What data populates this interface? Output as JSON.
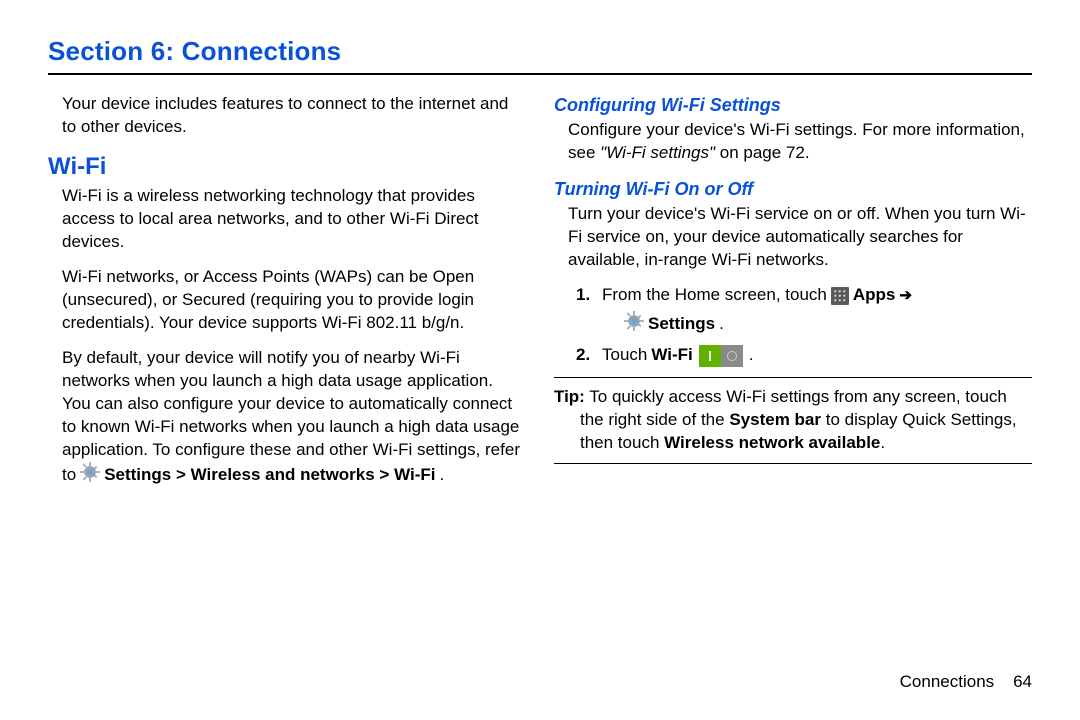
{
  "sectionTitle": "Section 6: Connections",
  "left": {
    "intro": "Your device includes features to connect to the internet and to other devices.",
    "wifiHeading": "Wi-Fi",
    "p1": "Wi-Fi is a wireless networking technology that provides access to local area networks, and to other Wi-Fi Direct devices.",
    "p2": "Wi-Fi networks, or Access Points (WAPs) can be Open (unsecured), or Secured (requiring you to provide login credentials). Your device supports Wi-Fi 802.11 b/g/n.",
    "p3a": "By default, your device will notify you of nearby Wi-Fi networks when you launch a high data usage application. You can also configure your device to automatically connect to known Wi-Fi networks when you launch a high data usage application. To configure these and other Wi-Fi settings, refer",
    "p3b_to": "to",
    "p3b_path": "Settings > Wireless and networks > Wi-Fi",
    "p3b_dot": "."
  },
  "right": {
    "configHeading": "Configuring Wi-Fi Settings",
    "config_a": "Configure your device's Wi-Fi settings. For more information, see",
    "config_ref": "\"Wi-Fi settings\"",
    "config_b": "on page 72.",
    "turnHeading": "Turning Wi-Fi On or Off",
    "turnIntro": "Turn your device's Wi-Fi service on or off. When you turn Wi-Fi service on, your device automatically searches for available, in-range Wi-Fi networks.",
    "step1_num": "1.",
    "step1_a": "From the Home screen, touch",
    "step1_apps": "Apps",
    "step1_settings": "Settings",
    "step1_dot": ".",
    "step2_num": "2.",
    "step2_a": "Touch",
    "step2_wifi": "Wi-Fi",
    "step2_dot": ".",
    "tip_label": "Tip:",
    "tip_a": "To quickly access Wi-Fi settings from any screen, touch",
    "tip_b1": "the right side of the",
    "tip_sysbar": "System bar",
    "tip_b2": "to display Quick Settings,",
    "tip_c1": "then touch",
    "tip_wna": "Wireless network available",
    "tip_c2": "."
  },
  "footer": {
    "label": "Connections",
    "page": "64"
  }
}
